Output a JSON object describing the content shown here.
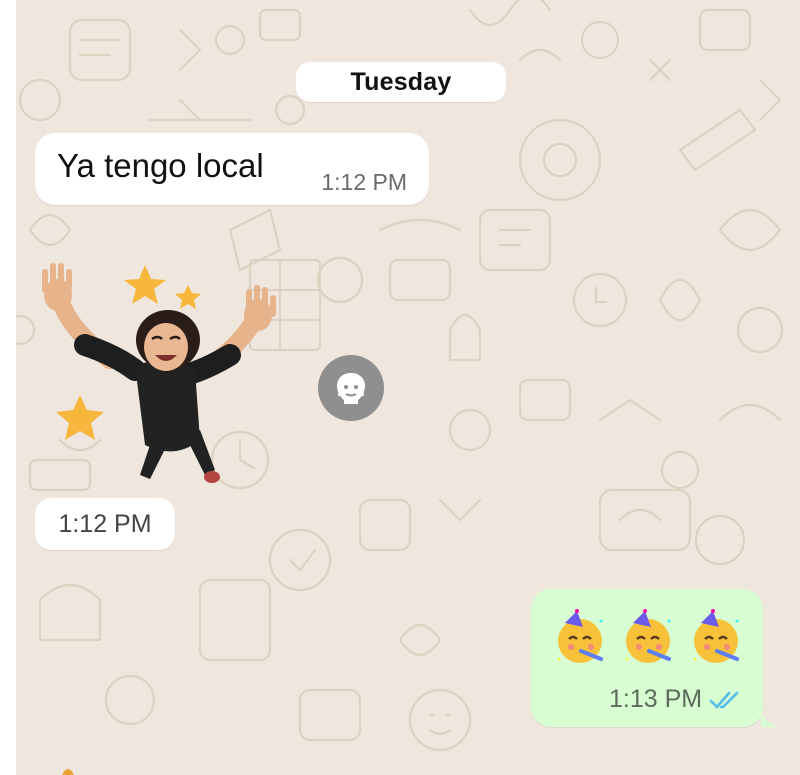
{
  "chat": {
    "date_label": "Tuesday",
    "messages": [
      {
        "direction": "incoming",
        "type": "text",
        "text": "Ya tengo local",
        "time": "1:12 PM"
      },
      {
        "direction": "incoming",
        "type": "sticker",
        "sticker": "avatar-jumping-with-stars",
        "time": "1:12 PM"
      },
      {
        "direction": "outgoing",
        "type": "emoji",
        "emojis": [
          "partying-face",
          "partying-face",
          "partying-face"
        ],
        "time": "1:13 PM",
        "status": "read"
      }
    ]
  },
  "colors": {
    "wallpaper": "#efe6dd",
    "incoming_bubble": "#ffffff",
    "outgoing_bubble": "#d8fdd3",
    "read_ticks": "#53bdeb",
    "forward_button": "#8f8f8f"
  },
  "icons": {
    "forward_button": "avatar-forward-icon",
    "read_status": "double-check-icon"
  }
}
